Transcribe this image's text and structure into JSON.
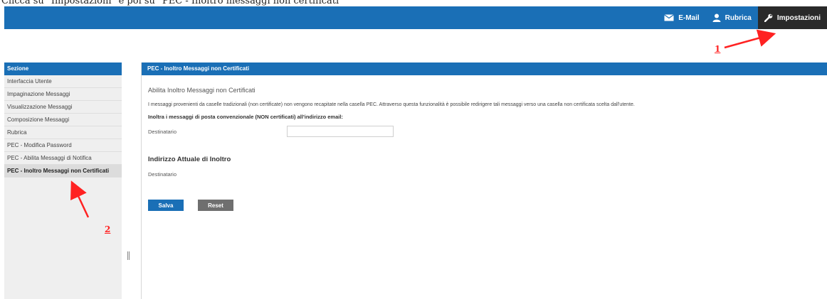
{
  "caption": "Clicca su \"Impostazioni\" e poi su \"PEC - Inoltro messaggi non certificati\"",
  "topnav": {
    "items": [
      {
        "label": "E-Mail",
        "icon": "envelope-icon"
      },
      {
        "label": "Rubrica",
        "icon": "user-icon"
      },
      {
        "label": "Impostazioni",
        "icon": "wrench-icon",
        "active": true
      }
    ]
  },
  "sidebar": {
    "title": "Sezione",
    "items": [
      {
        "label": "Interfaccia Utente"
      },
      {
        "label": "Impaginazione Messaggi"
      },
      {
        "label": "Visualizzazione Messaggi"
      },
      {
        "label": "Composizione Messaggi"
      },
      {
        "label": "Rubrica"
      },
      {
        "label": "PEC - Modifica Password"
      },
      {
        "label": "PEC - Abilita Messaggi di Notifica"
      },
      {
        "label": "PEC - Inoltro Messaggi non Certificati",
        "active": true
      }
    ]
  },
  "main": {
    "title": "PEC - Inoltro Messaggi non Certificati",
    "subtitle": "Abilita Inoltro Messaggi non Certificati",
    "description": "I messaggi provenienti da caselle tradizionali (non certificate) non vengono recapitate nella casella PEC. Attraverso questa funzionalità è possibile redirigere tali messaggi verso una casella non certificata scelta dall'utente.",
    "forward_label": "Inoltra i messaggi di posta convenzionale (NON certificati) all'indirizzo email:",
    "recipient_label": "Destinatario",
    "recipient_value": "",
    "current_heading": "Indirizzo Attuale di Inoltro",
    "current_recipient_label": "Destinatario",
    "save_label": "Salva",
    "reset_label": "Reset"
  },
  "annotations": {
    "step1": "1",
    "step2": "2",
    "color": "#ff2222"
  },
  "colors": {
    "brand": "#1a6fb6",
    "active_nav": "#2a2a2a"
  }
}
